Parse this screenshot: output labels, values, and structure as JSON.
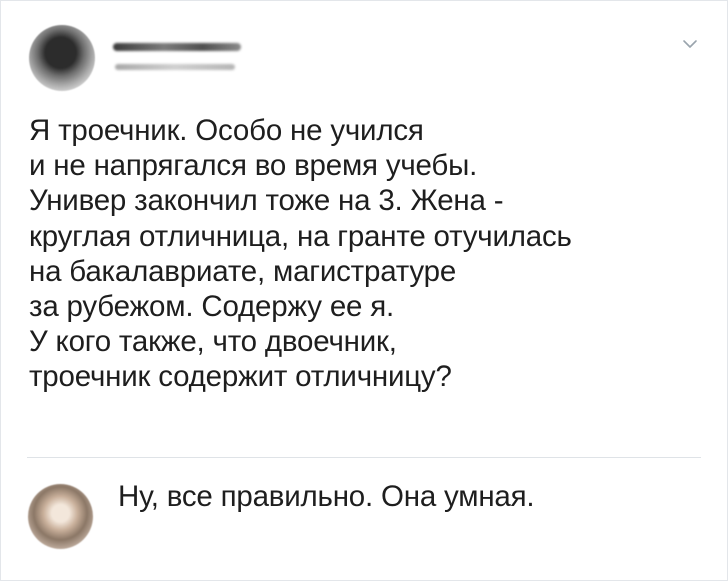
{
  "tweet": {
    "text": "Я троечник. Особо не учился\nи не напрягался во время учебы.\nУнивер закончил тоже на 3. Жена -\nкруглая отличница, на гранте отучилась\nна бакалавриате, магистратуре\nза рубежом. Содержу ее я.\nУ кого также, что двоечник,\nтроечник содержит отличницу?",
    "menu_icon": "chevron-down-icon"
  },
  "reply": {
    "text": "Ну, все правильно. Она умная."
  },
  "colors": {
    "text": "#1e1e1e",
    "divider": "#dfe3e7",
    "chevron": "#9aa4ad"
  }
}
